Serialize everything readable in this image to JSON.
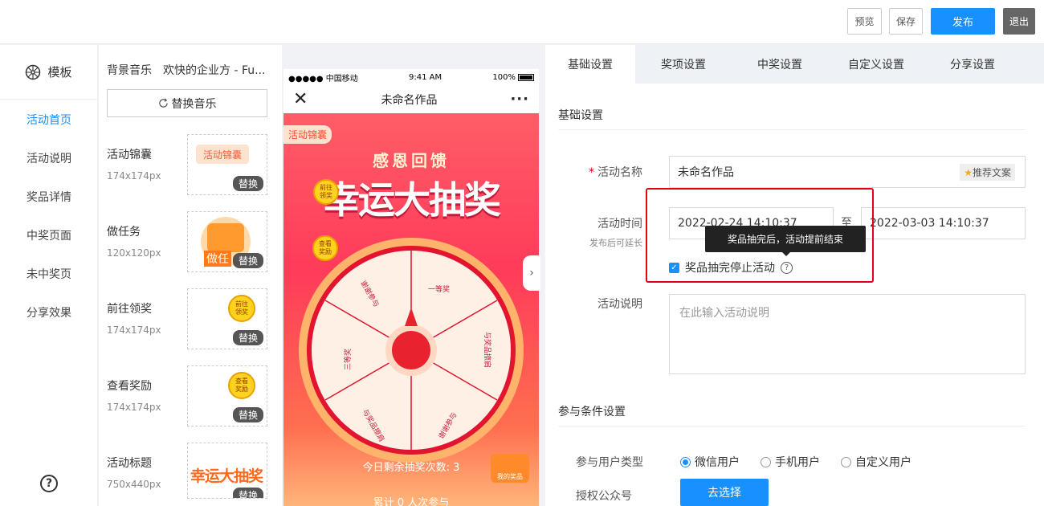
{
  "topbar": {
    "preview": "预览",
    "save": "保存",
    "publish": "发布",
    "exit": "退出"
  },
  "nav": {
    "template": "模板",
    "items": [
      "活动首页",
      "活动说明",
      "奖品详情",
      "中奖页面",
      "未中奖页",
      "分享效果"
    ],
    "help": "?"
  },
  "resources": {
    "bgm_label": "背景音乐",
    "bgm_name": "欢快的企业方 - Fu...",
    "replace_music": "替换音乐",
    "replace": "替换",
    "items": [
      {
        "label": "活动锦囊",
        "size": "174x174px",
        "thumb": "活动锦囊"
      },
      {
        "label": "做任务",
        "size": "120x120px",
        "thumb": "做任"
      },
      {
        "label": "前往领奖",
        "size": "174x174px",
        "thumb": "前往领奖"
      },
      {
        "label": "查看奖励",
        "size": "174x174px",
        "thumb": "查看奖励"
      },
      {
        "label": "活动标题",
        "size": "750x440px",
        "thumb": "幸运大抽奖"
      }
    ]
  },
  "phone": {
    "carrier": "●●●●● 中国移动 ",
    "time": "9:41 AM",
    "battery": "100%",
    "title": "未命名作品",
    "tips_badge": "活动锦囊",
    "subtitle": "感恩回馈",
    "headline": "幸运大抽奖",
    "goto_prize": "前往领奖",
    "view_reward": "查看奖励",
    "segments": [
      "谢谢参与",
      "一等奖",
      "与奖品擦肩",
      "谢谢参与",
      "与奖品擦肩",
      "三等奖"
    ],
    "remaining": "今日剩余抽奖次数: 3",
    "my_prize": "我的奖品",
    "total": "累计 0 人次参与"
  },
  "editor": {
    "tabs": [
      "基础设置",
      "奖项设置",
      "中奖设置",
      "自定义设置",
      "分享设置"
    ],
    "section_basic": "基础设置",
    "name_label": "活动名称",
    "name_value": "未命名作品",
    "recommend": "推荐文案",
    "time_label": "活动时间",
    "time_hint": "发布后可延长",
    "start": "2022-02-24 14:10:37",
    "to": "至",
    "end": "2022-03-03 14:10:37",
    "tooltip": "奖品抽完后，活动提前结束",
    "stop_checkbox": "奖品抽完停止活动",
    "desc_label": "活动说明",
    "desc_placeholder": "在此输入活动说明",
    "section_cond": "参与条件设置",
    "usertype_label": "参与用户类型",
    "usertypes": [
      "微信用户",
      "手机用户",
      "自定义用户"
    ],
    "account_label": "授权公众号",
    "choose": "去选择"
  },
  "colors": {
    "accent": "#1890ff",
    "highlight": "#e60012"
  }
}
